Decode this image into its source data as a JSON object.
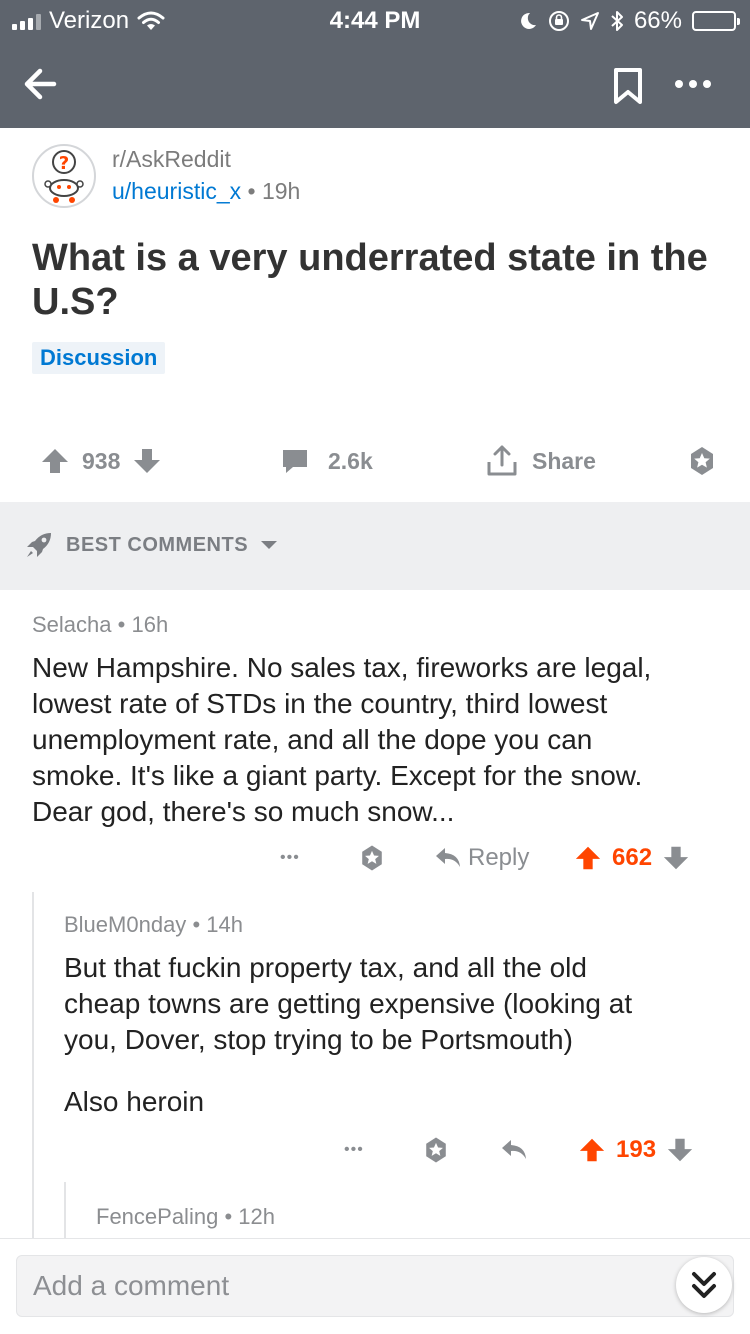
{
  "status_bar": {
    "carrier": "Verizon",
    "time": "4:44 PM",
    "battery_percent": "66%",
    "battery_level": 0.66
  },
  "nav": {
    "back_icon": "arrow-left-icon",
    "save_icon": "bookmark-icon",
    "more_icon": "more-dots-icon"
  },
  "post": {
    "subreddit": "r/AskReddit",
    "author": "u/heuristic_x",
    "age": "19h",
    "title": "What is a very underrated state in the U.S?",
    "flair": "Discussion",
    "score": "938",
    "comments": "2.6k",
    "share_label": "Share"
  },
  "sort": {
    "label": "BEST COMMENTS"
  },
  "comments": [
    {
      "author": "Selacha",
      "age": "16h",
      "body": [
        "New Hampshire. No sales tax, fireworks are legal,",
        "lowest rate of STDs in the country, third lowest",
        "unemployment rate, and all the dope you can",
        "smoke. It's like a giant party. Except for the snow.",
        "Dear god, there's so much snow..."
      ],
      "more": "•••",
      "reply_label": "Reply",
      "score": "662"
    },
    {
      "author": "BlueM0nday",
      "age": "14h",
      "body": [
        "But that fuckin property tax, and all the old",
        "cheap towns are getting expensive (looking at",
        "you, Dover, stop trying to be Portsmouth)"
      ],
      "body2": "Also heroin",
      "more": "•••",
      "score": "193"
    },
    {
      "author": "FencePaling",
      "age": "12h"
    }
  ],
  "composer": {
    "placeholder": "Add a comment"
  },
  "colors": {
    "header": "#5e646d",
    "upvote": "#ff4500",
    "link": "#0079d3"
  }
}
